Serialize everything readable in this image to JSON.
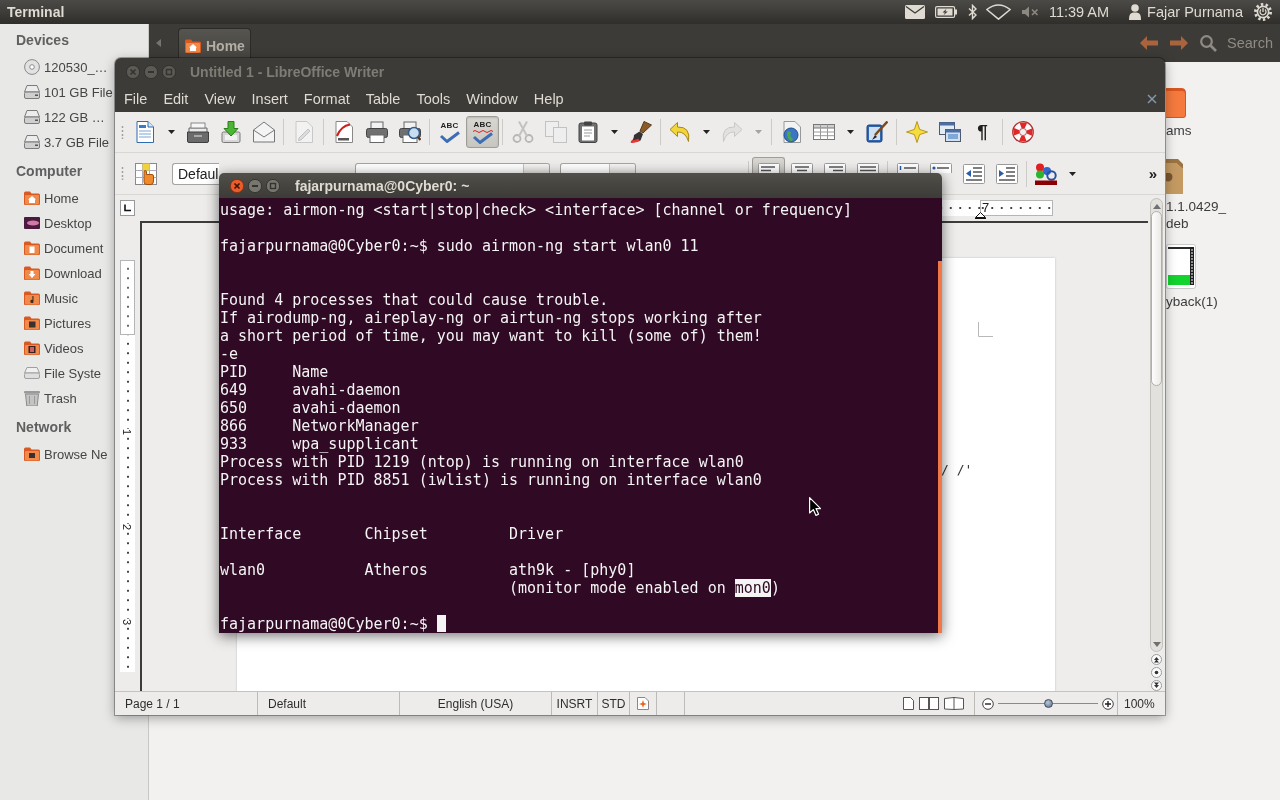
{
  "top_panel": {
    "app_name": "Terminal",
    "clock": "11:39 AM",
    "user_name": "Fajar Purnama"
  },
  "file_manager": {
    "location": "Home",
    "search": {
      "placeholder": "Search"
    },
    "sidebar": [
      {
        "heading": "Devices",
        "items": [
          {
            "kind": "disc",
            "label": "120530_…"
          },
          {
            "kind": "drive",
            "label": "101 GB File"
          },
          {
            "kind": "drive",
            "label": "122 GB …"
          },
          {
            "kind": "drive",
            "label": "3.7 GB File"
          }
        ]
      },
      {
        "heading": "Computer",
        "items": [
          {
            "kind": "home",
            "label": "Home"
          },
          {
            "kind": "desktop",
            "label": "Desktop"
          },
          {
            "kind": "documents",
            "label": "Document"
          },
          {
            "kind": "downloads",
            "label": "Download"
          },
          {
            "kind": "music",
            "label": "Music"
          },
          {
            "kind": "pictures",
            "label": "Pictures"
          },
          {
            "kind": "videos",
            "label": "Videos"
          },
          {
            "kind": "filesystem",
            "label": "File Syste"
          },
          {
            "kind": "trash",
            "label": "Trash"
          }
        ]
      },
      {
        "heading": "Network",
        "items": [
          {
            "kind": "network",
            "label": "Browse Ne"
          }
        ]
      }
    ],
    "files": [
      {
        "kind": "folder",
        "label": [
          "ams"
        ]
      },
      {
        "kind": "package",
        "label": [
          "1.1.0429_",
          "deb"
        ]
      },
      {
        "kind": "video",
        "label": [
          "yback(1)"
        ]
      }
    ]
  },
  "writer": {
    "title": "Untitled 1 - LibreOffice Writer",
    "menu": [
      "File",
      "Edit",
      "View",
      "Insert",
      "Format",
      "Table",
      "Tools",
      "Window",
      "Help"
    ],
    "standard_toolbar": [
      [
        {
          "kind": "menu_button",
          "pressed": false,
          "disabled": false
        },
        {
          "kind": "button",
          "pressed": false,
          "disabled": false
        },
        {
          "kind": "button",
          "pressed": false,
          "disabled": false
        },
        {
          "kind": "button",
          "pressed": false,
          "disabled": false
        }
      ],
      [
        {
          "kind": "button",
          "pressed": false,
          "disabled": true
        }
      ],
      [
        {
          "kind": "button",
          "pressed": false,
          "disabled": false
        },
        {
          "kind": "button",
          "pressed": false,
          "disabled": false
        },
        {
          "kind": "button",
          "pressed": false,
          "disabled": false
        }
      ],
      [
        {
          "kind": "button",
          "glyph": "ABC",
          "pressed": false,
          "disabled": false
        },
        {
          "kind": "button",
          "glyph": "ABC",
          "pressed": true,
          "disabled": false
        }
      ],
      [
        {
          "kind": "button",
          "pressed": false,
          "disabled": true
        },
        {
          "kind": "button",
          "pressed": false,
          "disabled": true
        },
        {
          "kind": "menu_button",
          "pressed": false,
          "disabled": false
        },
        {
          "kind": "button",
          "pressed": false,
          "disabled": false
        }
      ],
      [
        {
          "kind": "menu_button",
          "pressed": false,
          "disabled": false
        },
        {
          "kind": "menu_button",
          "pressed": false,
          "disabled": true
        }
      ],
      [
        {
          "kind": "button",
          "pressed": false,
          "disabled": false
        },
        {
          "kind": "menu_button",
          "pressed": false,
          "disabled": false
        },
        {
          "kind": "button",
          "pressed": false,
          "disabled": false
        }
      ],
      [
        {
          "kind": "button",
          "pressed": false,
          "disabled": false
        },
        {
          "kind": "button",
          "pressed": false,
          "disabled": false
        },
        {
          "kind": "button",
          "glyph": "¶",
          "pressed": false,
          "disabled": false
        }
      ],
      [
        {
          "kind": "button",
          "pressed": false,
          "disabled": false
        }
      ]
    ],
    "formatting_toolbar": {
      "groups": [
        [
          {
            "kind": "button",
            "pressed": false
          },
          {
            "kind": "field",
            "value": "Defaul"
          },
          {
            "kind": "field"
          },
          {
            "kind": "field"
          }
        ],
        [
          {
            "kind": "button",
            "pressed": true
          },
          {
            "kind": "button",
            "pressed": false
          },
          {
            "kind": "button",
            "pressed": false
          },
          {
            "kind": "button",
            "pressed": false
          }
        ],
        [
          {
            "kind": "button",
            "pressed": false
          },
          {
            "kind": "button",
            "pressed": false
          },
          {
            "kind": "button",
            "pressed": false
          },
          {
            "kind": "button",
            "pressed": false
          }
        ],
        [
          {
            "kind": "menu_button",
            "pressed": false
          }
        ]
      ],
      "overflow": "»"
    },
    "ruler_label": "7",
    "vertical_ruler_labels": [
      "1",
      "2",
      "3"
    ],
    "page_text": "/ /'",
    "status_bar": {
      "page": "Page 1 / 1",
      "page_style": "Default",
      "language": "English (USA)",
      "insert_mode": "INSRT",
      "selection_mode": "STD",
      "zoom_slider": {
        "level": 0.5
      },
      "zoom": "100%"
    }
  },
  "terminal": {
    "title": "fajarpurnama@0Cyber0: ~",
    "lines": [
      {
        "kind": "text",
        "text": "usage: airmon-ng <start|stop|check> <interface> [channel or frequency]"
      },
      {
        "kind": "blank"
      },
      {
        "kind": "text",
        "text": "fajarpurnama@0Cyber0:~$ sudo airmon-ng start wlan0 11"
      },
      {
        "kind": "blank"
      },
      {
        "kind": "blank"
      },
      {
        "kind": "text",
        "text": "Found 4 processes that could cause trouble."
      },
      {
        "kind": "text",
        "text": "If airodump-ng, aireplay-ng or airtun-ng stops working after"
      },
      {
        "kind": "text",
        "text": "a short period of time, you may want to kill (some of) them!"
      },
      {
        "kind": "text",
        "text": "-e"
      },
      {
        "kind": "text",
        "text": "PID\tName"
      },
      {
        "kind": "text",
        "text": "649\tavahi-daemon"
      },
      {
        "kind": "text",
        "text": "650\tavahi-daemon"
      },
      {
        "kind": "text",
        "text": "866\tNetworkManager"
      },
      {
        "kind": "text",
        "text": "933\twpa_supplicant"
      },
      {
        "kind": "text",
        "text": "Process with PID 1219 (ntop) is running on interface wlan0"
      },
      {
        "kind": "text",
        "text": "Process with PID 8851 (iwlist) is running on interface wlan0"
      },
      {
        "kind": "blank"
      },
      {
        "kind": "blank"
      },
      {
        "kind": "text",
        "text": "Interface\tChipset\t\tDriver"
      },
      {
        "kind": "blank"
      },
      {
        "kind": "text",
        "text": "wlan0\t\tAtheros\t\tath9k - [phy0]"
      },
      {
        "kind": "text",
        "text": "\t\t\t\t(monitor mode enabled on ",
        "selected_text": "mon0",
        "text_after": ")"
      },
      {
        "kind": "blank"
      },
      {
        "kind": "input",
        "text": "fajarpurnama@0Cyber0:~$"
      }
    ]
  }
}
